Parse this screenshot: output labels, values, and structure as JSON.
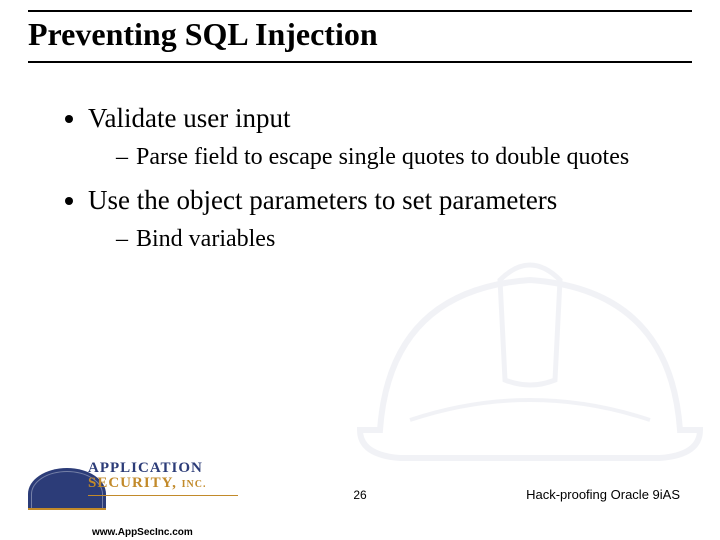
{
  "title": "Preventing SQL Injection",
  "bullets": [
    {
      "text": "Validate user input",
      "sub": [
        "Parse field to escape single quotes to double quotes"
      ]
    },
    {
      "text": "Use the object parameters to set parameters",
      "sub": [
        "Bind variables"
      ]
    }
  ],
  "logo": {
    "line1": "APPLICATION",
    "line2": "SECURITY,",
    "inc": "INC.",
    "url": "www.AppSecInc.com"
  },
  "slide_number": "26",
  "footer_text": "Hack-proofing Oracle 9iAS"
}
